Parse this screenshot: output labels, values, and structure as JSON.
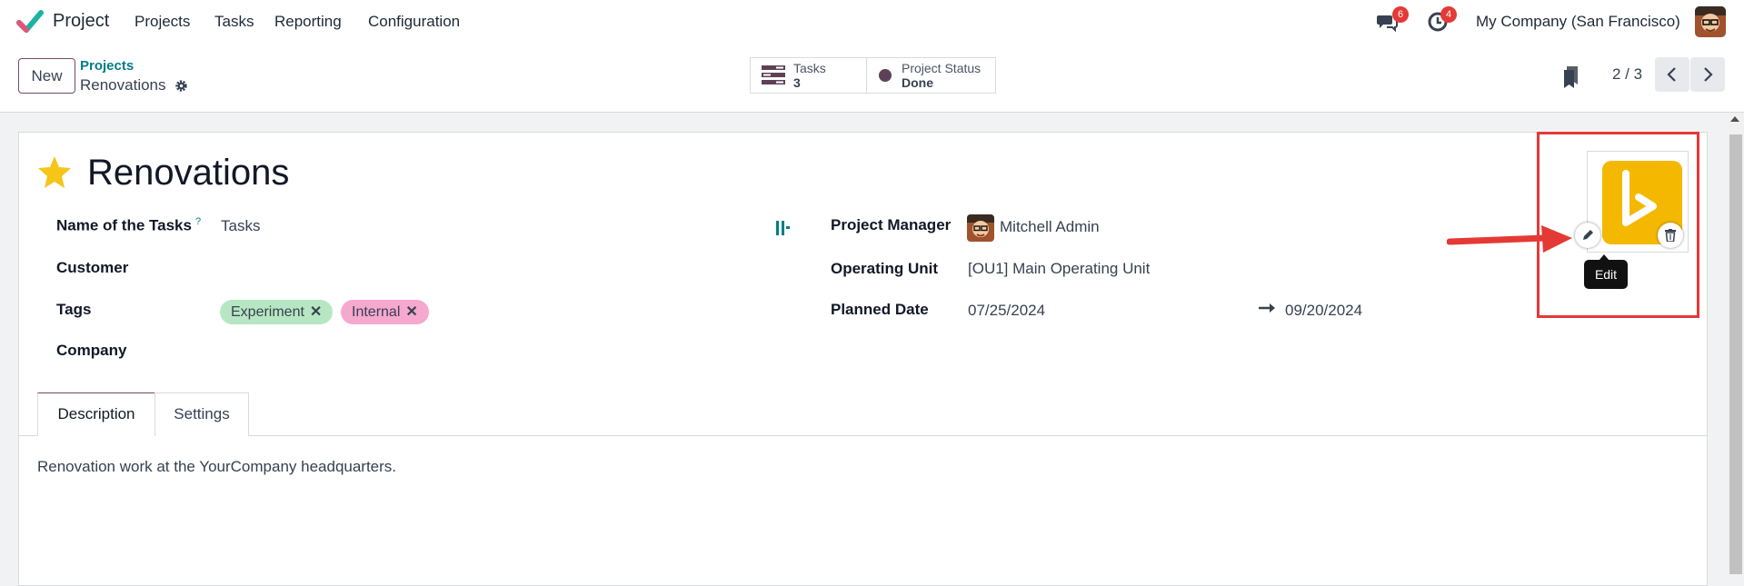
{
  "app": {
    "name": "Project"
  },
  "nav": {
    "menus": [
      "Projects",
      "Tasks",
      "Reporting",
      "Configuration"
    ],
    "messages_count": "6",
    "activities_count": "4",
    "company": "My Company (San Francisco)"
  },
  "control_panel": {
    "new_label": "New",
    "breadcrumb_parent": "Projects",
    "breadcrumb_current": "Renovations",
    "smart_tasks_label": "Tasks",
    "smart_tasks_value": "3",
    "smart_status_label": "Project Status",
    "smart_status_value": "Done",
    "pager": "2 / 3"
  },
  "form": {
    "title": "Renovations",
    "fields_left": {
      "name_of_tasks_label": "Name of the Tasks",
      "name_of_tasks_help": "?",
      "name_of_tasks_value": "Tasks",
      "customer_label": "Customer",
      "tags_label": "Tags",
      "tags": [
        "Experiment",
        "Internal"
      ],
      "tag_remove": "✕",
      "company_label": "Company"
    },
    "fields_right": {
      "manager_label": "Project Manager",
      "manager_value": "Mitchell Admin",
      "operating_unit_label": "Operating Unit",
      "operating_unit_value": "[OU1] Main Operating Unit",
      "planned_date_label": "Planned Date",
      "planned_start": "07/25/2024",
      "planned_end": "09/20/2024"
    },
    "tabs": [
      "Description",
      "Settings"
    ],
    "description": "Renovation work at the YourCompany headquarters.",
    "image_tooltip": "Edit"
  },
  "colors": {
    "brand": "#714b67",
    "teal": "#017e84",
    "tag_green": "#b7e7c2",
    "tag_pink": "#f6a8cf",
    "annotation_red": "#e53935",
    "logo_yellow": "#f5b800"
  },
  "icons": {
    "logo": "project-check-icon",
    "messages": "chat-icon",
    "activities": "clock-icon",
    "gear": "gear-icon",
    "tasks": "list-icon",
    "status": "dot-icon",
    "bookmark": "bookmark-icon",
    "prev": "chevron-left-icon",
    "next": "chevron-right-icon",
    "star": "star-icon",
    "edit": "pencil-icon",
    "delete": "trash-icon",
    "arrow": "arrow-right-icon"
  }
}
